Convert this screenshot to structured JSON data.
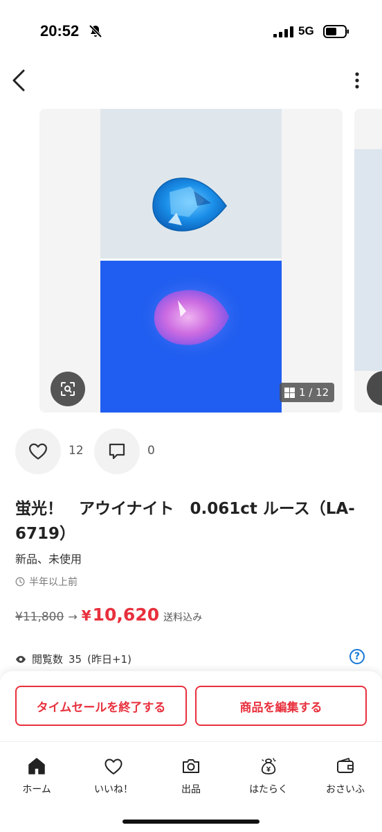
{
  "status_bar": {
    "time": "20:52",
    "network": "5G"
  },
  "header": {
    "back_icon": "chevron-left-icon",
    "more_icon": "more-vertical-icon"
  },
  "gallery": {
    "counter": "1 / 12",
    "total_images": 12,
    "current_image": 1
  },
  "engagement": {
    "likes_count": "12",
    "comments_count": "0"
  },
  "item": {
    "title": "蛍光！　アウイナイト　0.061ct ルース（LA-6719）",
    "condition": "新品、未使用",
    "posted": "半年以上前",
    "original_price": "¥11,800",
    "arrow": "→",
    "price_symbol": "¥",
    "price_value": "10,620",
    "shipping": "送料込み",
    "views_label": "閲覧数",
    "views_count": "35",
    "views_yesterday": "(昨日+1)"
  },
  "actions": {
    "end_time_sale": "タイムセールを終了する",
    "edit_item": "商品を編集する"
  },
  "tabs": [
    {
      "label": "ホーム",
      "icon": "home-icon"
    },
    {
      "label": "いいね！",
      "icon": "heart-icon"
    },
    {
      "label": "出品",
      "icon": "camera-icon"
    },
    {
      "label": "はたらく",
      "icon": "money-bag-icon"
    },
    {
      "label": "おさいふ",
      "icon": "wallet-icon"
    }
  ],
  "colors": {
    "accent_red": "#e8303d",
    "help_blue": "#1677d8"
  }
}
